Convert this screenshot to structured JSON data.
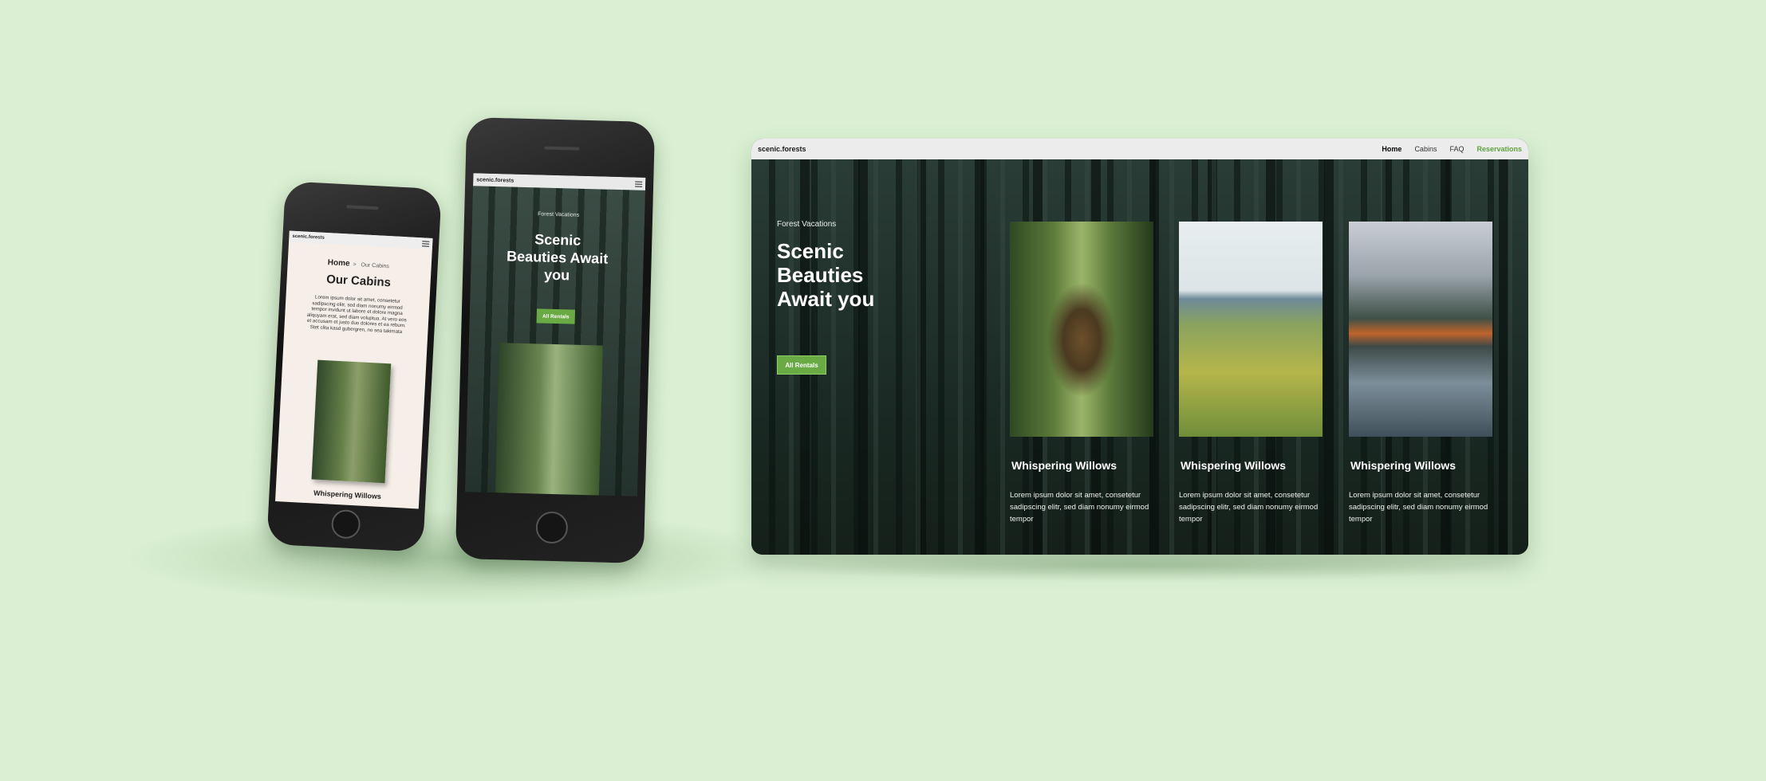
{
  "brand": "scenic.forests",
  "nav": {
    "home": "Home",
    "cabins": "Cabins",
    "faq": "FAQ",
    "reservations": "Reservations"
  },
  "hero": {
    "eyebrow": "Forest Vacations",
    "title": "Scenic Beauties Await you",
    "button": "All Rentals"
  },
  "cards": [
    {
      "title": "Whispering Willows",
      "desc": "Lorem ipsum dolor sit amet, consetetur sadipscing elitr, sed diam nonumy eirmod tempor"
    },
    {
      "title": "Whispering Willows",
      "desc": "Lorem ipsum dolor sit amet, consetetur sadipscing elitr, sed diam nonumy eirmod tempor"
    },
    {
      "title": "Whispering Willows",
      "desc": "Lorem ipsum dolor sit amet, consetetur sadipscing elitr, sed diam nonumy eirmod tempor"
    }
  ],
  "mobile_small": {
    "crumb_home": "Home",
    "crumb_current": "Our Cabins",
    "title": "Our Cabins",
    "text": "Lorem ipsum dolor sit amet, consetetur sadipscing elitr, sed diam nonumy eirmod tempor invidunt ut labore et dolore magna aliquyam erat, sed diam voluptua. At vero eos et accusam et justo duo dolores et ea rebum. Stet clita kasd gubergren, no sea takimata",
    "card_title": "Whispering Willows"
  },
  "colors": {
    "background": "#dbf0d3",
    "accent": "#6aaa45",
    "nav_cta": "#5ea43c"
  }
}
